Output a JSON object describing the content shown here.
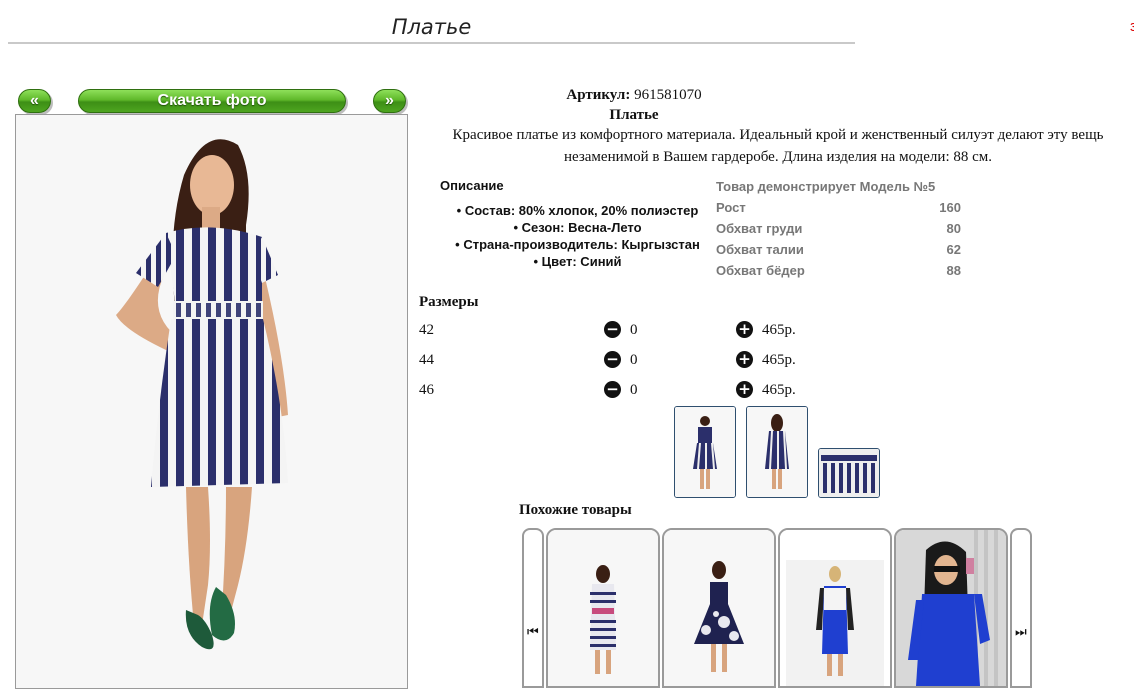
{
  "page": {
    "title": "Платье",
    "corner_mark": "з"
  },
  "toolbar": {
    "prev_label": "«",
    "download_label": "Скачать фото",
    "next_label": "»"
  },
  "product": {
    "article_label": "Артикул:",
    "article_value": "961581070",
    "name": "Платье",
    "description": "Красивое платье из комфортного материала. Идеальный крой и женственный силуэт делают эту вещь незаменимой в Вашем гардеробе. Длина изделия на модели: 88 см."
  },
  "properties": {
    "title": "Описание",
    "items": [
      "Состав: 80% хлопок, 20% полиэстер",
      "Сезон: Весна-Лето",
      "Страна-производитель: Кыргызстан",
      "Цвет: Синий"
    ]
  },
  "model": {
    "title": "Товар демонстрирует Модель №5",
    "rows": [
      {
        "label": "Рост",
        "value": "160"
      },
      {
        "label": "Обхват груди",
        "value": "80"
      },
      {
        "label": "Обхват талии",
        "value": "62"
      },
      {
        "label": "Обхват бёдер",
        "value": "88"
      }
    ]
  },
  "sizes": {
    "title": "Размеры",
    "rows": [
      {
        "size": "42",
        "qty": "0",
        "price": "465р."
      },
      {
        "size": "44",
        "qty": "0",
        "price": "465р."
      },
      {
        "size": "46",
        "qty": "0",
        "price": "465р."
      }
    ],
    "minus_icon": "minus-circle-icon",
    "plus_icon": "plus-circle-icon"
  },
  "similar": {
    "title": "Похожие товары",
    "prev_icon": "⏮",
    "next_icon": "⏭"
  },
  "colors": {
    "button_green": "#5fb82a",
    "dress_navy": "#2b2f6b",
    "blue_dress": "#1f3fd0"
  }
}
